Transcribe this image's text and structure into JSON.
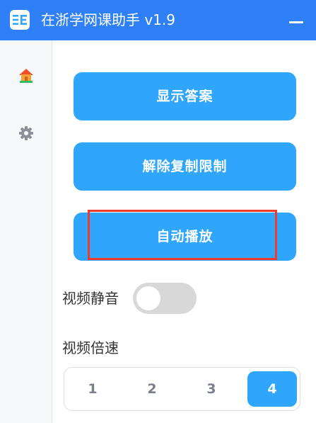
{
  "titlebar": {
    "title": "在浙学网课助手 v1.9",
    "logo_icon": "app-logo-icon",
    "minimize_icon": "minimize-icon",
    "color": "#2f80f7"
  },
  "sidebar": {
    "items": [
      {
        "name": "home",
        "icon": "home-icon"
      },
      {
        "name": "settings",
        "icon": "gear-icon"
      }
    ]
  },
  "main": {
    "buttons": {
      "show_answer": "显示答案",
      "remove_copy_limit": "解除复制限制",
      "auto_play": "自动播放"
    },
    "mute": {
      "label": "视频静音",
      "enabled": false
    },
    "speed": {
      "label": "视频倍速",
      "options": [
        "1",
        "2",
        "3",
        "4"
      ],
      "selected": "4"
    },
    "accent_color": "#2fa6fb",
    "highlight_color": "#f03a2a"
  }
}
